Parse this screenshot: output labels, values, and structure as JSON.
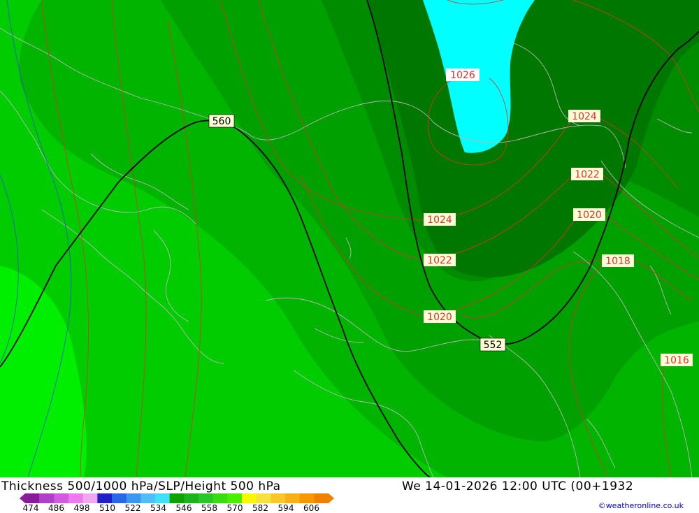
{
  "map": {
    "contour_labels": {
      "thickness_560": "560",
      "thickness_552": "552",
      "slp_1026": "1026",
      "slp_1024_a": "1024",
      "slp_1024_b": "1024",
      "slp_1022_a": "1022",
      "slp_1022_b": "1022",
      "slp_1020_a": "1020",
      "slp_1020_b": "1020",
      "slp_1018": "1018",
      "slp_1016": "1016"
    }
  },
  "footer": {
    "title": "Thickness 500/1000 hPa/SLP/Height 500 hPa",
    "datetime": "We 14-01-2026 12:00 UTC (00+1932",
    "credit": "©weatheronline.co.uk",
    "legend": {
      "colors": [
        "#8a1c9c",
        "#b040c8",
        "#d25ae0",
        "#ee7af0",
        "#f0a8f0",
        "#2020c8",
        "#2868e8",
        "#3c96f0",
        "#50bef4",
        "#40e0f8",
        "#10a000",
        "#1cb41c",
        "#28c828",
        "#38dc10",
        "#48f000",
        "#f8f800",
        "#f8e040",
        "#f8c828",
        "#f8b018",
        "#f89800",
        "#f08000"
      ],
      "ticks": [
        "474",
        "486",
        "498",
        "510",
        "522",
        "534",
        "546",
        "558",
        "570",
        "582",
        "594",
        "606"
      ]
    }
  }
}
